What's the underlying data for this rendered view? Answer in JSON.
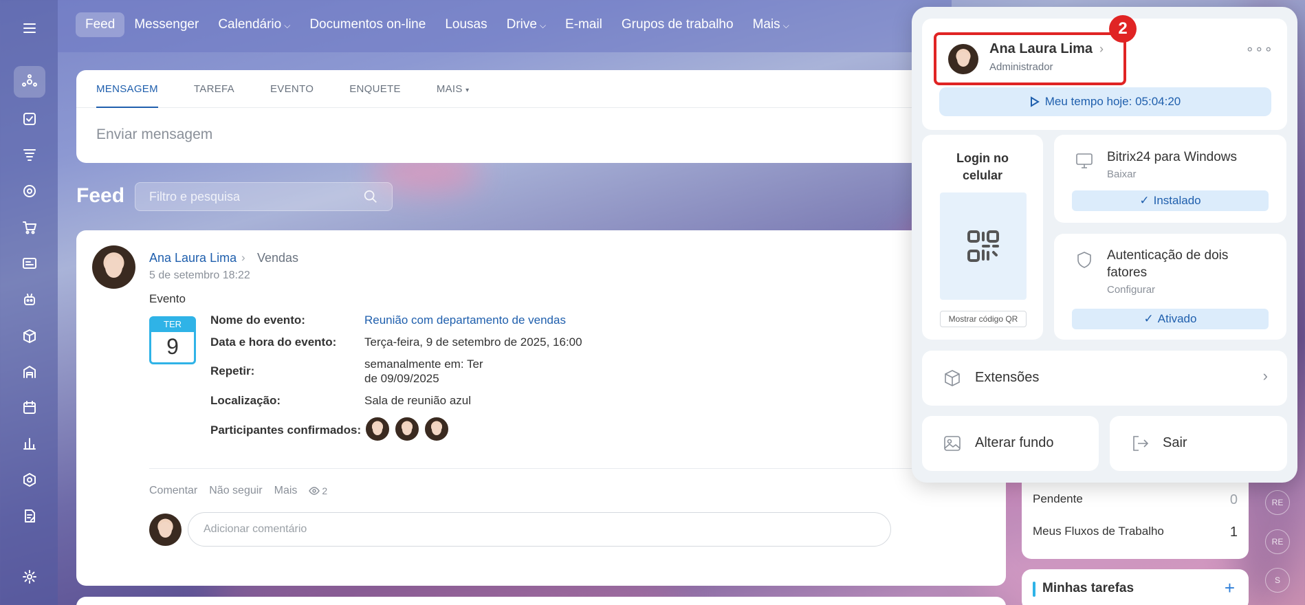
{
  "topnav": {
    "items": [
      "Feed",
      "Messenger",
      "Calendário",
      "Documentos on-line",
      "Lousas",
      "Drive",
      "E-mail",
      "Grupos de trabalho",
      "Mais"
    ],
    "active": "Feed"
  },
  "composer": {
    "tabs": [
      "MENSAGEM",
      "TAREFA",
      "EVENTO",
      "ENQUETE",
      "MAIS"
    ],
    "placeholder": "Enviar mensagem"
  },
  "feed": {
    "title": "Feed",
    "filter_placeholder": "Filtro e pesquisa"
  },
  "post": {
    "author": "Ana Laura Lima",
    "group": "Vendas",
    "date": "5 de setembro 18:22",
    "type": "Evento",
    "calendar": {
      "dow": "TER",
      "day": "9"
    },
    "labels": {
      "name": "Nome do evento:",
      "datetime": "Data e hora do evento:",
      "repeat": "Repetir:",
      "location": "Localização:",
      "participants": "Participantes confirmados:"
    },
    "values": {
      "name": "Reunião com departamento de vendas",
      "datetime": "Terça-feira, 9 de setembro de 2025, 16:00",
      "repeat_line1": "semanalmente em: Ter",
      "repeat_line2": "de 09/09/2025",
      "location": "Sala de reunião azul"
    },
    "actions": {
      "comment": "Comentar",
      "unfollow": "Não seguir",
      "more": "Mais",
      "views": "2"
    },
    "comment_placeholder": "Adicionar comentário"
  },
  "widget": {
    "rows": [
      {
        "label": "Pendente",
        "value": "0"
      },
      {
        "label": "Meus Fluxos de Trabalho",
        "value": "1"
      }
    ],
    "tasks_title": "Minhas tarefas",
    "tasks_add": "+"
  },
  "mini_avatars": [
    "RE",
    "RE",
    "S"
  ],
  "popup": {
    "badge": "2",
    "name": "Ana Laura Lima",
    "role": "Administrador",
    "timer": "Meu tempo hoje: 05:04:20",
    "qr": {
      "title_line1": "Login no",
      "title_line2": "celular",
      "button": "Mostrar código QR"
    },
    "windows": {
      "title": "Bitrix24 para Windows",
      "subtitle": "Baixar",
      "status": "Instalado"
    },
    "twofa": {
      "title_line1": "Autenticação de dois",
      "title_line2": "fatores",
      "subtitle": "Configurar",
      "status": "Ativado"
    },
    "extensions": "Extensões",
    "change_background": "Alterar fundo",
    "logout": "Sair"
  },
  "colors": {
    "accent": "#1f5fad",
    "highlight": "#e02424",
    "calendar": "#2fb3e7"
  }
}
